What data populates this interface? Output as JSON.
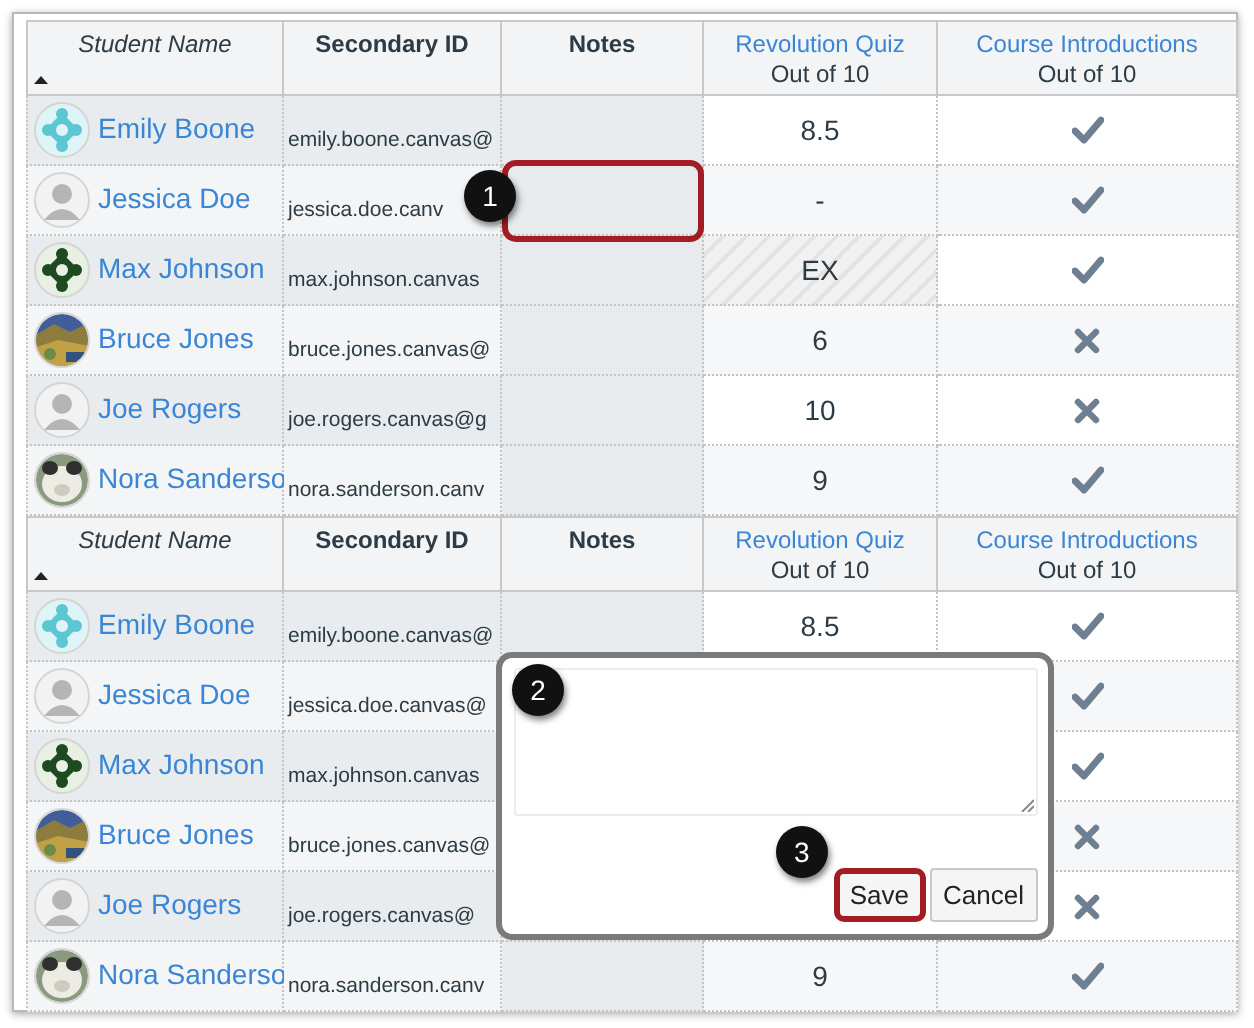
{
  "tables": [
    {
      "columns": [
        {
          "title": "Student Name",
          "kind": "sortable"
        },
        {
          "title": "Secondary ID",
          "kind": "plain"
        },
        {
          "title": "Notes",
          "kind": "plain"
        },
        {
          "title": "Revolution Quiz",
          "subtitle": "Out of 10",
          "kind": "assignment"
        },
        {
          "title": "Course Introductions",
          "subtitle": "Out of 10",
          "kind": "assignment"
        }
      ],
      "rows": [
        {
          "name": "Emily Boone",
          "avatar": {
            "kind": "pattern-light"
          },
          "secondary_id": "emily.boone.canvas@",
          "quiz": "8.5",
          "quiz_excused": false,
          "intro_complete": true
        },
        {
          "name": "Jessica Doe",
          "avatar": {
            "kind": "person"
          },
          "secondary_id": "jessica.doe.canv",
          "quiz": "-",
          "quiz_excused": false,
          "intro_complete": true,
          "notes_highlighted": true,
          "callout": "1"
        },
        {
          "name": "Max Johnson",
          "avatar": {
            "kind": "pattern-dark"
          },
          "secondary_id": "max.johnson.canvas",
          "quiz": "EX",
          "quiz_excused": true,
          "intro_complete": true
        },
        {
          "name": "Bruce Jones",
          "avatar": {
            "kind": "photo-landscape"
          },
          "secondary_id": "bruce.jones.canvas@",
          "quiz": "6",
          "quiz_excused": false,
          "intro_complete": false
        },
        {
          "name": "Joe Rogers",
          "avatar": {
            "kind": "person"
          },
          "secondary_id": "joe.rogers.canvas@g",
          "quiz": "10",
          "quiz_excused": false,
          "intro_complete": false
        },
        {
          "name": "Nora Sanderso",
          "avatar": {
            "kind": "photo-animal"
          },
          "secondary_id": "nora.sanderson.canv",
          "quiz": "9",
          "quiz_excused": false,
          "intro_complete": true
        }
      ]
    },
    {
      "columns": [
        {
          "title": "Student Name",
          "kind": "sortable"
        },
        {
          "title": "Secondary ID",
          "kind": "plain"
        },
        {
          "title": "Notes",
          "kind": "plain"
        },
        {
          "title": "Revolution Quiz",
          "subtitle": "Out of 10",
          "kind": "assignment"
        },
        {
          "title": "Course Introductions",
          "subtitle": "Out of 10",
          "kind": "assignment"
        }
      ],
      "rows": [
        {
          "name": "Emily Boone",
          "avatar": {
            "kind": "pattern-light"
          },
          "secondary_id": "emily.boone.canvas@",
          "quiz": "8.5",
          "quiz_excused": false,
          "intro_complete": true
        },
        {
          "name": "Jessica Doe",
          "avatar": {
            "kind": "person"
          },
          "secondary_id": "jessica.doe.canvas@",
          "intro_complete": true
        },
        {
          "name": "Max Johnson",
          "avatar": {
            "kind": "pattern-dark"
          },
          "secondary_id": "max.johnson.canvas",
          "intro_complete": true
        },
        {
          "name": "Bruce Jones",
          "avatar": {
            "kind": "photo-landscape"
          },
          "secondary_id": "bruce.jones.canvas@",
          "intro_complete": false
        },
        {
          "name": "Joe Rogers",
          "avatar": {
            "kind": "person"
          },
          "secondary_id": "joe.rogers.canvas@",
          "intro_complete": false
        },
        {
          "name": "Nora Sanderso",
          "avatar": {
            "kind": "photo-animal"
          },
          "secondary_id": "nora.sanderson.canv",
          "quiz": "9",
          "quiz_excused": false,
          "intro_complete": true
        }
      ],
      "notes_editor": {
        "callout": "2",
        "save": "Save",
        "cancel": "Cancel",
        "save_callout": "3"
      }
    }
  ]
}
